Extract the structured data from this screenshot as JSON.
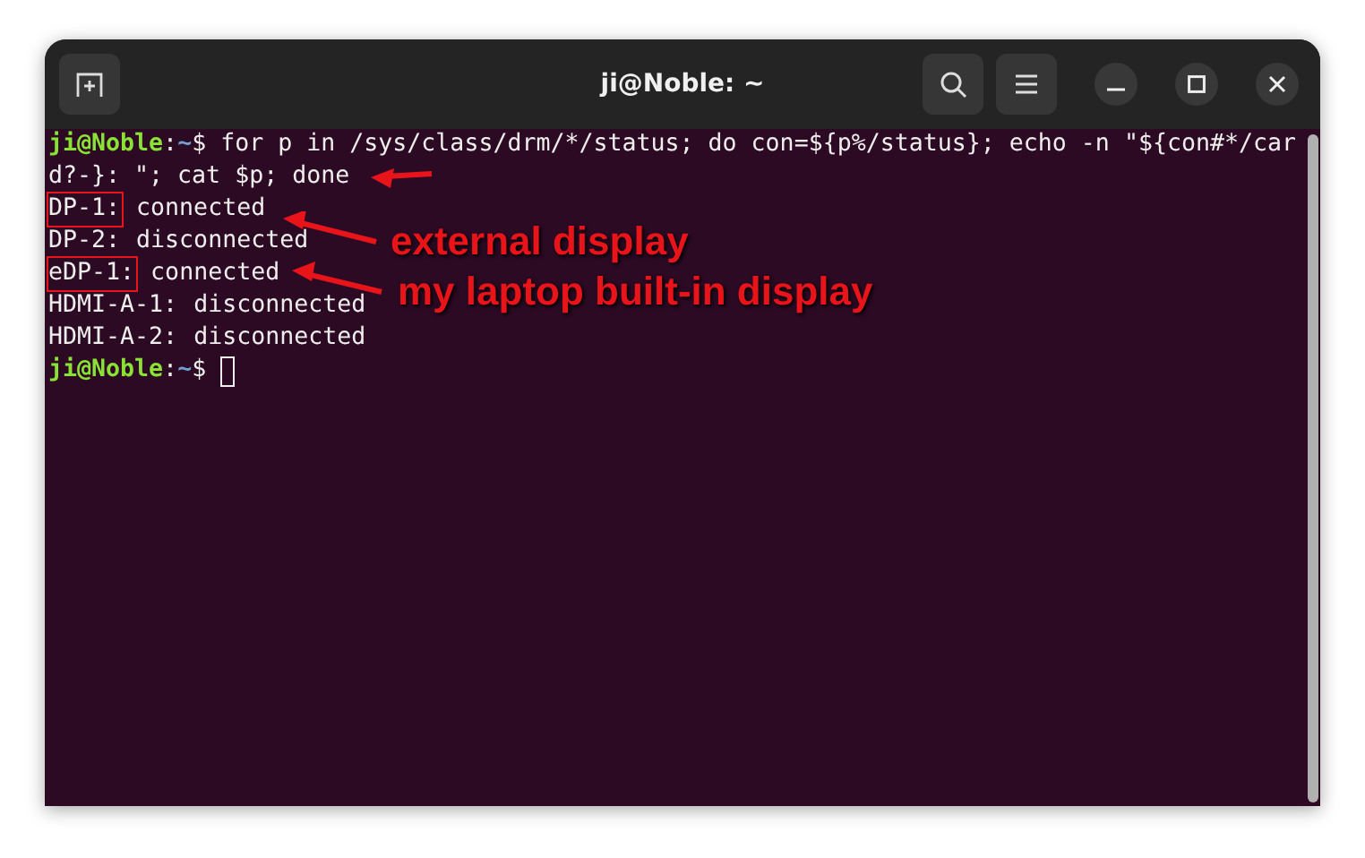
{
  "window": {
    "title": "ji@Noble: ~"
  },
  "terminal": {
    "lines": [
      {
        "kind": "prompt",
        "user_host": "ji@Noble",
        "separator": ":",
        "path": "~",
        "symbol": "$",
        "text": "for p in /sys/class/drm/*/status; do con=${p%/status}; echo -n \"${con#*/car"
      },
      {
        "kind": "plain",
        "text": "d?-}: \"; cat $p; done"
      },
      {
        "kind": "status",
        "name": "DP-1:",
        "status": "connected",
        "highlighted": true
      },
      {
        "kind": "status",
        "name": "DP-2:",
        "status": "disconnected",
        "highlighted": false
      },
      {
        "kind": "status",
        "name": "eDP-1:",
        "status": "connected",
        "highlighted": true
      },
      {
        "kind": "status",
        "name": "HDMI-A-1:",
        "status": "disconnected",
        "highlighted": false
      },
      {
        "kind": "status",
        "name": "HDMI-A-2:",
        "status": "disconnected",
        "highlighted": false
      },
      {
        "kind": "prompt",
        "user_host": "ji@Noble",
        "separator": ":",
        "path": "~",
        "symbol": "$",
        "cursor": true
      }
    ]
  },
  "annotations": [
    {
      "text": "external display"
    },
    {
      "text": "my laptop built-in display"
    }
  ]
}
